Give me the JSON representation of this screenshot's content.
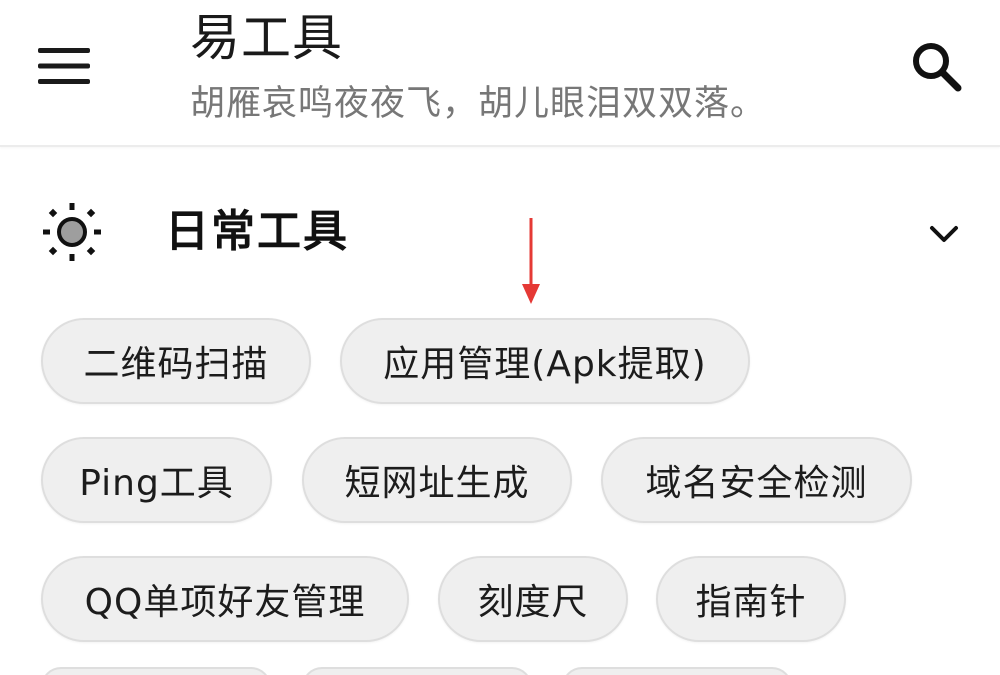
{
  "toolbar": {
    "title": "易工具",
    "subtitle": "胡雁哀鸣夜夜飞，胡儿眼泪双双落。",
    "menu_icon": "hamburger-menu-icon",
    "search_icon": "search-icon"
  },
  "section": {
    "title": "日常工具",
    "icon": "sun-icon",
    "toggle_icon": "chevron-down-icon",
    "expanded": true
  },
  "chips": [
    {
      "label": "二维码扫描"
    },
    {
      "label": "应用管理(Apk提取)"
    },
    {
      "label": "Ping工具"
    },
    {
      "label": "短网址生成"
    },
    {
      "label": "域名安全检测"
    },
    {
      "label": "QQ单项好友管理"
    },
    {
      "label": "刻度尺"
    },
    {
      "label": "指南针"
    }
  ],
  "annotation": {
    "arrow_color": "#e53935"
  },
  "colors": {
    "chip_background": "#efefef",
    "chip_border": "#dedede",
    "subtitle_text": "#777777",
    "primary_text": "#1a1a1a"
  }
}
